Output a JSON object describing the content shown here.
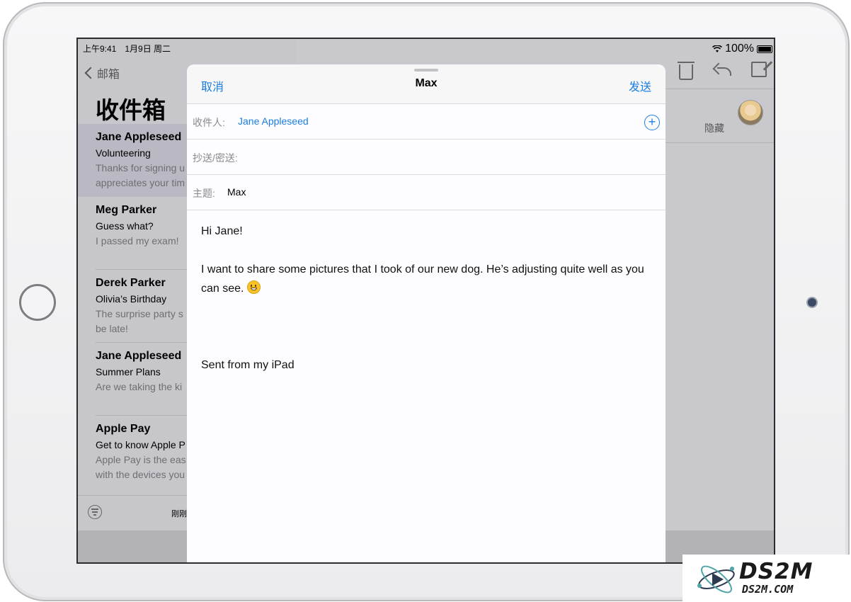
{
  "status_bar": {
    "time_date": "上午9:41　1月9日 周二",
    "battery_percent": "100%"
  },
  "mailbox": {
    "back_label": "邮箱",
    "title": "收件箱",
    "items": [
      {
        "sender": "Jane Appleseed",
        "subject": "Volunteering",
        "preview_1": "Thanks for signing u",
        "preview_2": "appreciates your tim",
        "selected": true
      },
      {
        "sender": "Meg Parker",
        "subject": "Guess what?",
        "preview_1": "I passed my exam!",
        "preview_2": ""
      },
      {
        "sender": "Derek Parker",
        "subject": "Olivia’s Birthday",
        "preview_1": "The surprise party s",
        "preview_2": "be late!"
      },
      {
        "sender": "Jane Appleseed",
        "subject": "Summer Plans",
        "preview_1": "Are we taking the ki",
        "preview_2": ""
      },
      {
        "sender": "Apple Pay",
        "subject": "Get to know Apple P",
        "preview_1": "Apple Pay is the eas",
        "preview_2": "with the devices you"
      }
    ],
    "updated_label": "刚刚"
  },
  "detail": {
    "hide_label": "隐藏"
  },
  "compose": {
    "cancel_label": "取消",
    "title": "Max",
    "send_label": "发送",
    "to_label": "收件人:",
    "to_value": "Jane Appleseed",
    "cc_label": "抄送/密送:",
    "subject_label": "主题:",
    "subject_value": "Max",
    "body": {
      "greeting": "Hi Jane!",
      "paragraph": "I want to share some pictures that I took of our new dog. He’s adjusting quite well as you can see.",
      "signature": "Sent from my iPad"
    }
  },
  "watermark": {
    "big_text": "DS2M",
    "small_text": "DS2M.COM"
  },
  "colors": {
    "accent": "#1a7de1",
    "sheet_background": "#fdfdff",
    "dimmed_background": "#c7c7cb"
  }
}
